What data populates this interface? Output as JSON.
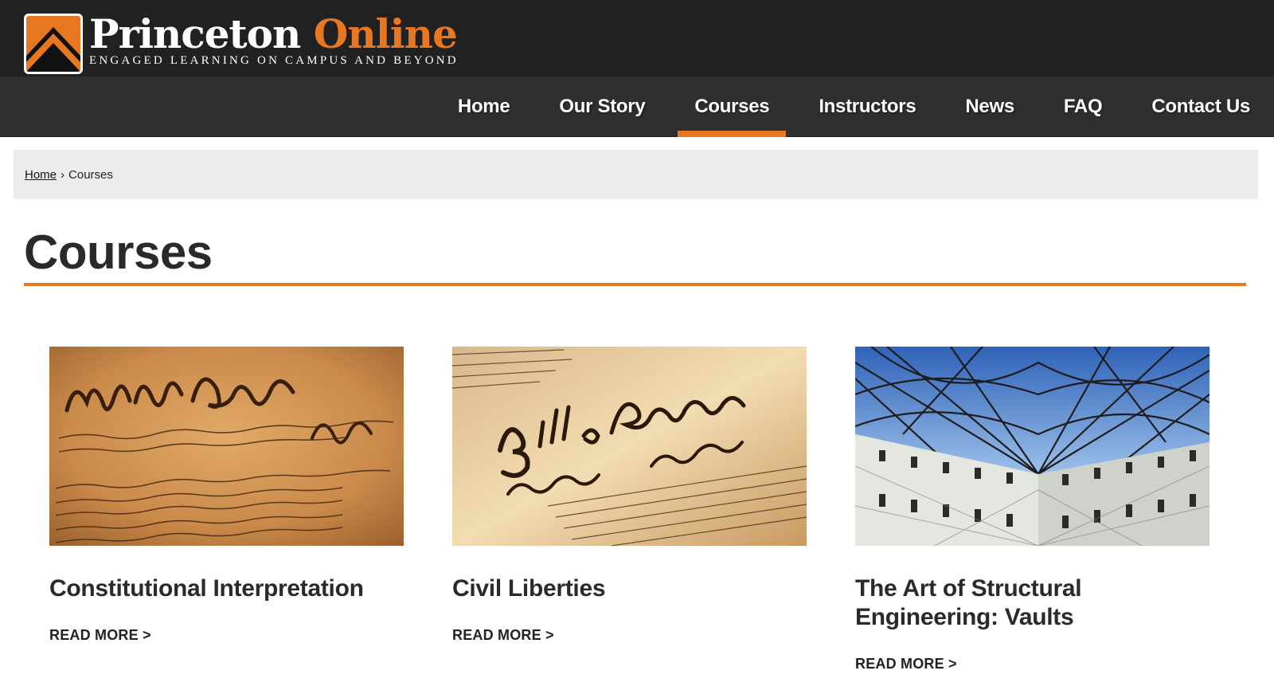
{
  "header": {
    "logo_primary": "Princeton",
    "logo_secondary": "Online",
    "tagline": "ENGAGED LEARNING ON CAMPUS AND BEYOND",
    "logo_icon": "chevron-up-mark-icon"
  },
  "nav": {
    "items": [
      {
        "label": "Home"
      },
      {
        "label": "Our Story"
      },
      {
        "label": "Courses",
        "active": true
      },
      {
        "label": "Instructors"
      },
      {
        "label": "News"
      },
      {
        "label": "FAQ"
      },
      {
        "label": "Contact Us"
      }
    ]
  },
  "breadcrumb": {
    "home": "Home",
    "separator": "›",
    "current": "Courses"
  },
  "page": {
    "title": "Courses"
  },
  "courses": [
    {
      "title": "Constitutional Interpretation",
      "read_more": "READ MORE >",
      "image": "we-the-people-document"
    },
    {
      "title": "Civil Liberties",
      "read_more": "READ MORE >",
      "image": "bill-of-rights-document"
    },
    {
      "title": "The Art of Structural Engineering: Vaults",
      "read_more": "READ MORE >",
      "image": "glass-vault-roof"
    }
  ],
  "colors": {
    "accent": "#e87722",
    "header_bg": "#212121",
    "nav_bg": "#2f2f2f",
    "breadcrumb_bg": "#ececec"
  }
}
